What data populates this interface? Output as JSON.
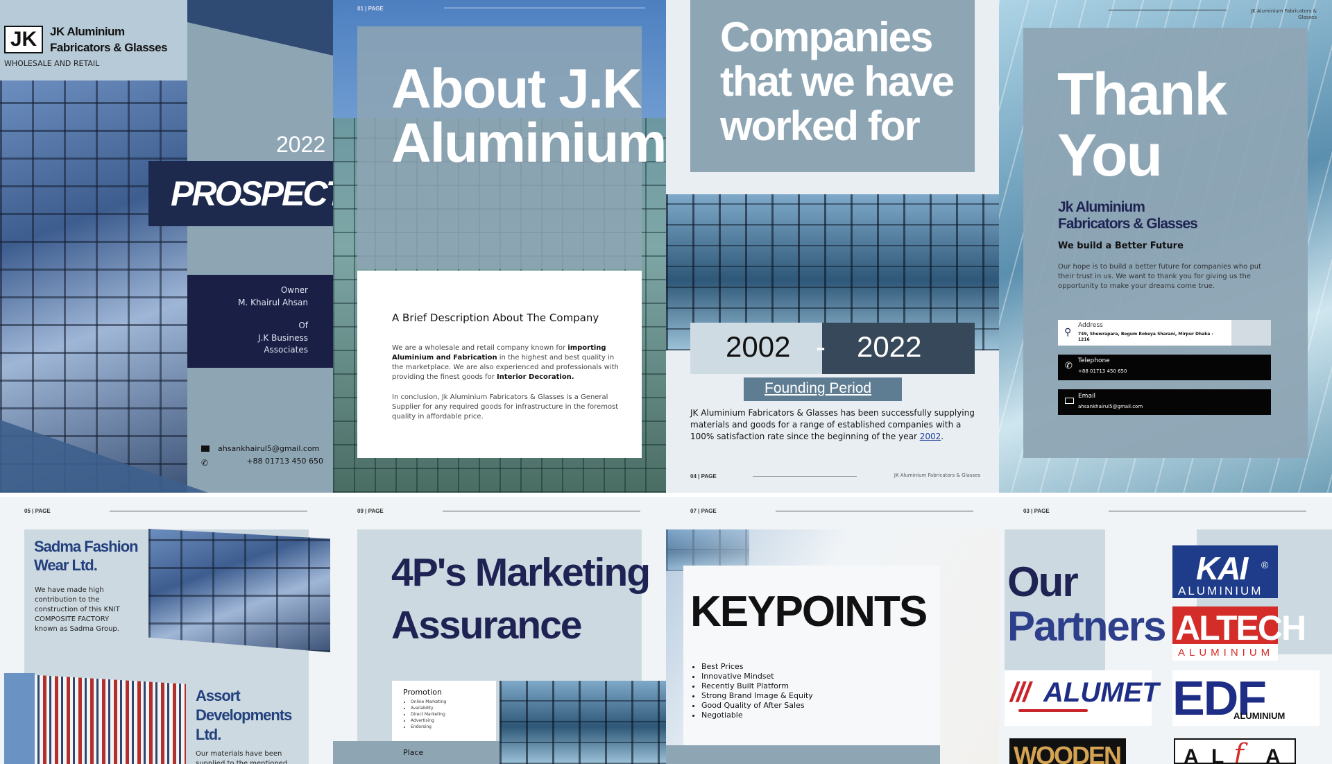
{
  "p1": {
    "logo_text": "JK",
    "company_line1": "JK Aluminium",
    "company_line2": "Fabricators & Glasses",
    "tagline": "WHOLESALE AND RETAIL",
    "year": "2022",
    "title": "PROSPECTUS",
    "owner_label": "Owner",
    "owner_name": "M. Khairul Ahsan",
    "of_label": "Of",
    "org_line1": "J.K Business",
    "org_line2": "Associates",
    "email": "ahsankhairul5@gmail.com",
    "phone": "+88 01713 450 650"
  },
  "p2": {
    "page_label": "01 | PAGE",
    "title_line1": "About J.K",
    "title_line2": "Aluminium",
    "subtitle": "A Brief Description About The Company",
    "para1_a": "We are a wholesale and retail company known for",
    "para1_b": "importing Aluminium and Fabrication",
    "para1_c": "in the highest and best quality in the marketplace. We are also experienced and professionals with providing the finest goods for",
    "para1_d": "Interior Decoration.",
    "para2": "In conclusion, Jk Aluminium Fabricators & Glasses is a General Supplier for any required goods for infrastructure in the foremost quality in affordable price."
  },
  "p3": {
    "title_line1": "Companies",
    "title_line2": "that we have",
    "title_line3": "worked for",
    "year_start": "2002",
    "dash": "-",
    "year_end": "2022",
    "period_label": "Founding Period",
    "body": "JK Aluminium Fabricators & Glasses has been successfully supplying materials and goods for a range of established companies with a 100% satisfaction rate since the beginning of the year",
    "body_year": "2002",
    "body_end": ".",
    "page_label": "04 | PAGE",
    "footer_company": "JK Aluminium Fabricators & Glasses"
  },
  "p4": {
    "header_company": "JK Aluminium Fabricators & Glasses",
    "title_line1": "Thank",
    "title_line2": "You",
    "company_line1": "Jk Aluminium",
    "company_line2": "Fabricators & Glasses",
    "slogan": "We build a Better Future",
    "body": "Our hope is to build a better future for companies who put their trust in us. We want to thank you for giving us the opportunity to make your dreams come true.",
    "address_label": "Address",
    "address_value": "749, Shewrapara, Begum Rokeya Sharani, Mirpur Dhaka - 1216",
    "telephone_label": "Telephone",
    "telephone_value": "+88 01713 450 650",
    "email_label": "Email",
    "email_value": "ahsankhairul5@gmail.com"
  },
  "p5": {
    "page_label": "05 | PAGE",
    "company1_line1": "Sadma Fashion",
    "company1_line2": "Wear Ltd.",
    "company1_body": "We have made high contribution to the construction of this KNIT COMPOSITE FACTORY known as Sadma Group.",
    "company2_line1": "Assort",
    "company2_line2": "Developments",
    "company2_line3": "Ltd.",
    "company2_body": "Our materials have been supplied to the mentioned"
  },
  "p6": {
    "page_label": "09 | PAGE",
    "title_line1": "4P's Marketing",
    "title_line2": "Assurance",
    "promotion_label": "Promotion",
    "promotion_items": [
      "Online Marketing",
      "Availability",
      "Direct Marketing",
      "Advertising",
      "Endorsing"
    ],
    "place_label": "Place"
  },
  "p7": {
    "page_label": "07 | PAGE",
    "title": "KEYPOINTS",
    "items": [
      "Best Prices",
      "Innovative Mindset",
      "Recently Built Platform",
      "Strong Brand Image & Equity",
      "Good Quality of After Sales",
      "Negotiable"
    ]
  },
  "p8": {
    "page_label": "03 | PAGE",
    "title_line1": "Our",
    "title_line2": "Partners",
    "kai_name": "KAI",
    "kai_reg": "®",
    "kai_sub": "ALUMINIUM",
    "altech_name": "ALTECH",
    "altech_sub": "ALUMINIUM",
    "alumet_slashes": "///",
    "alumet_name": "ALUMET",
    "edf_name": "EDF",
    "edf_sub": "ALUMINIUM",
    "wooden_name": "WOODEN",
    "alfa_a1": "A",
    "alfa_l": "L",
    "alfa_f": "f",
    "alfa_a2": "A"
  },
  "colors": {
    "navy": "#1e2353",
    "slate": "#8ea5b4",
    "slate_light": "#cdd9e1",
    "dark_band": "#37485a"
  }
}
